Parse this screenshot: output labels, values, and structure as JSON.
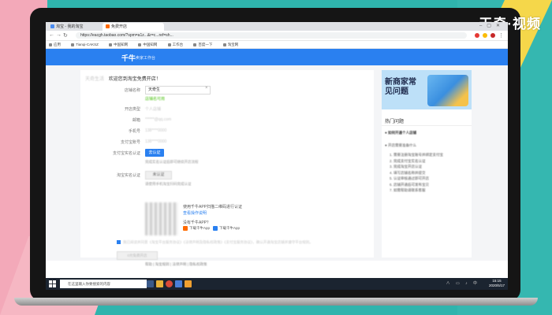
{
  "watermark": "天奇·视频",
  "browser": {
    "tabs": [
      {
        "label": "淘宝 - 我的淘宝"
      },
      {
        "label": "免费开店"
      }
    ],
    "url": "https://eacgh.taobao.com/?spm=a1z...&r=c...ref=sh...",
    "bookmarks": [
      "应用",
      "Tianqi-CAKSZ",
      "中国知网",
      "中国知网",
      "工作台",
      "百度一下",
      "淘宝网"
    ]
  },
  "header": {
    "logo": "千牛",
    "subtitle": "卖家工作台"
  },
  "form": {
    "title_prefix": "天奇生活",
    "title": "欢迎您到淘宝免费开店！",
    "shop_name_label": "店铺名称",
    "shop_name_value": "天奇生",
    "check_text": "店铺名可用",
    "open_type_label": "开店类型",
    "open_type_value": "个人店铺",
    "phone_label": "手机号",
    "phone_value": "138****0000",
    "email_label": "邮箱",
    "email_value": "******@qq.com",
    "alipay_label": "支付宝账号",
    "alipay_value": "138****0000",
    "auth_label": "支付宝实名认证",
    "auth_button": "去认证",
    "auth_hint": "完成实名认证后即可继续开店流程",
    "face_label": "淘宝实名认证",
    "face_box": "未认证",
    "face_hint": "请使用手机淘宝扫码完成认证",
    "qr_line1": "使用千牛APP扫描二维码进行认证",
    "qr_line2": "查看操作说明",
    "qr_line3": "没有千牛APP？",
    "dl_1": "下载千牛App",
    "dl_2": "下载千牛App",
    "agreement": "我已阅读并同意《淘宝平台服务协议》《法律声明及隐私权政策》《支付宝服务协议》，确认开通淘宝店铺并遵守平台规则。",
    "submit": "0元免费开店",
    "footer": "帮助 | 淘宝规则 | 法律声明 | 隐私权政策"
  },
  "sidebar": {
    "banner_title": "新商家常见问题",
    "hot_title": "热门问题",
    "faqs": [
      "如何开通个人店铺",
      "开店需要准备什么"
    ],
    "body": [
      "1. 需要注册淘宝账号并绑定支付宝",
      "2. 完成支付宝实名认证",
      "3. 完成淘宝开店认证",
      "4. 填写店铺名称并提交",
      "5. 认证审核通过即可开店",
      "6. 店铺开通后可发布宝贝",
      "7. 如需帮助请联系客服"
    ]
  },
  "taskbar": {
    "search_placeholder": "在这里输入你要搜索的内容",
    "time": "15:15",
    "date": "2020/5/17"
  },
  "colors": {
    "accent": "#2a80f0",
    "check": "#52c41a"
  }
}
